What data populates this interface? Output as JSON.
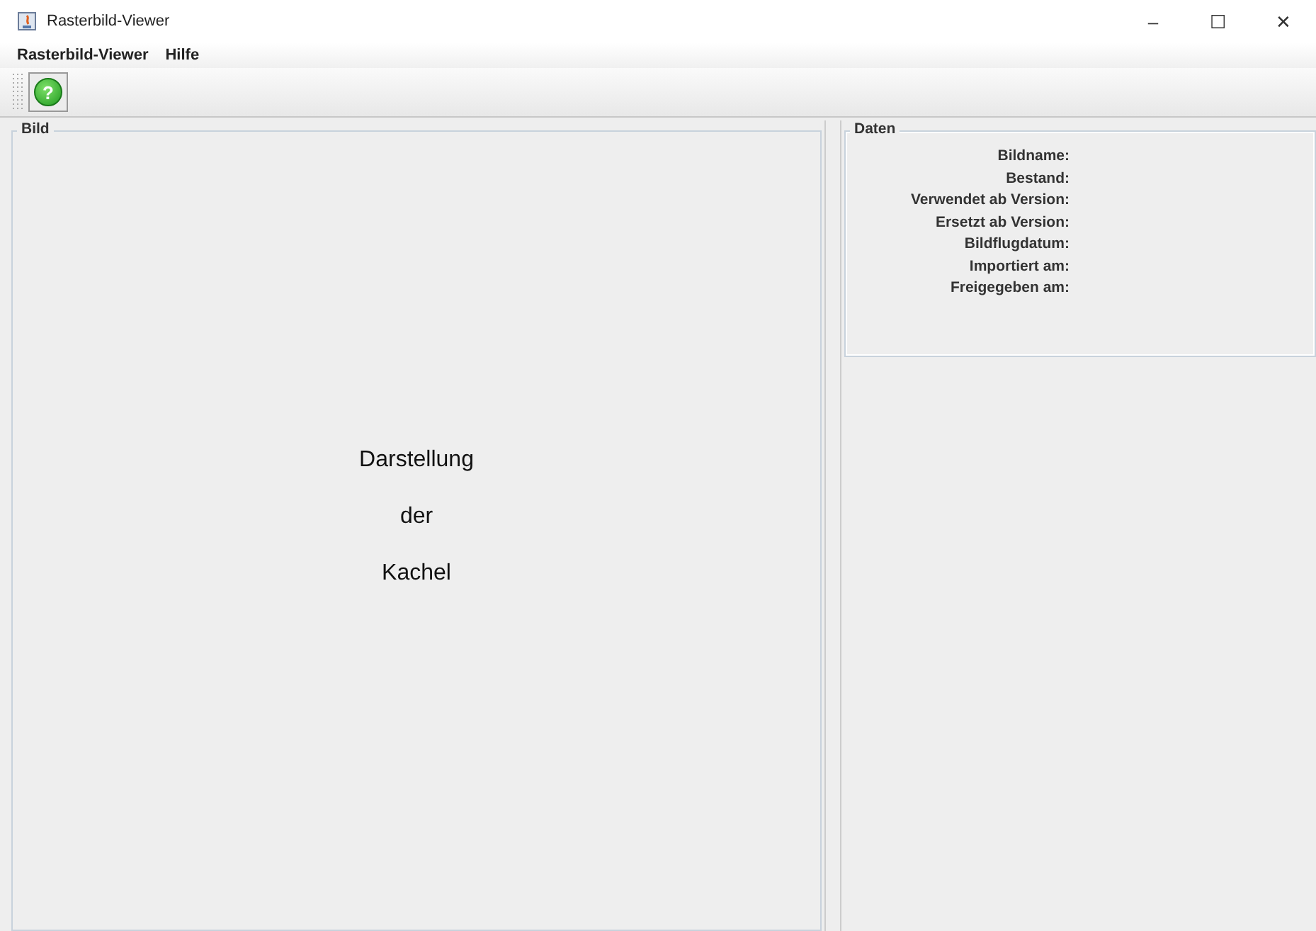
{
  "window": {
    "title": "Rasterbild-Viewer",
    "controls": [
      "–",
      "☐",
      "✕"
    ]
  },
  "menu": [
    "Rasterbild-Viewer",
    "Hilfe"
  ],
  "toolbar": [
    {
      "kind": "help",
      "label": "?"
    }
  ],
  "image_panel": {
    "title": "Bild",
    "lines": [
      "Darstellung",
      "der",
      "Kachel"
    ]
  },
  "data_panel": {
    "title": "Daten",
    "fields": [
      "Bildname:",
      "Bestand:",
      "Verwendet ab Version:",
      "Ersetzt ab Version:",
      "Bildflugdatum:",
      "Importiert am:",
      "Freigegeben am:"
    ]
  }
}
